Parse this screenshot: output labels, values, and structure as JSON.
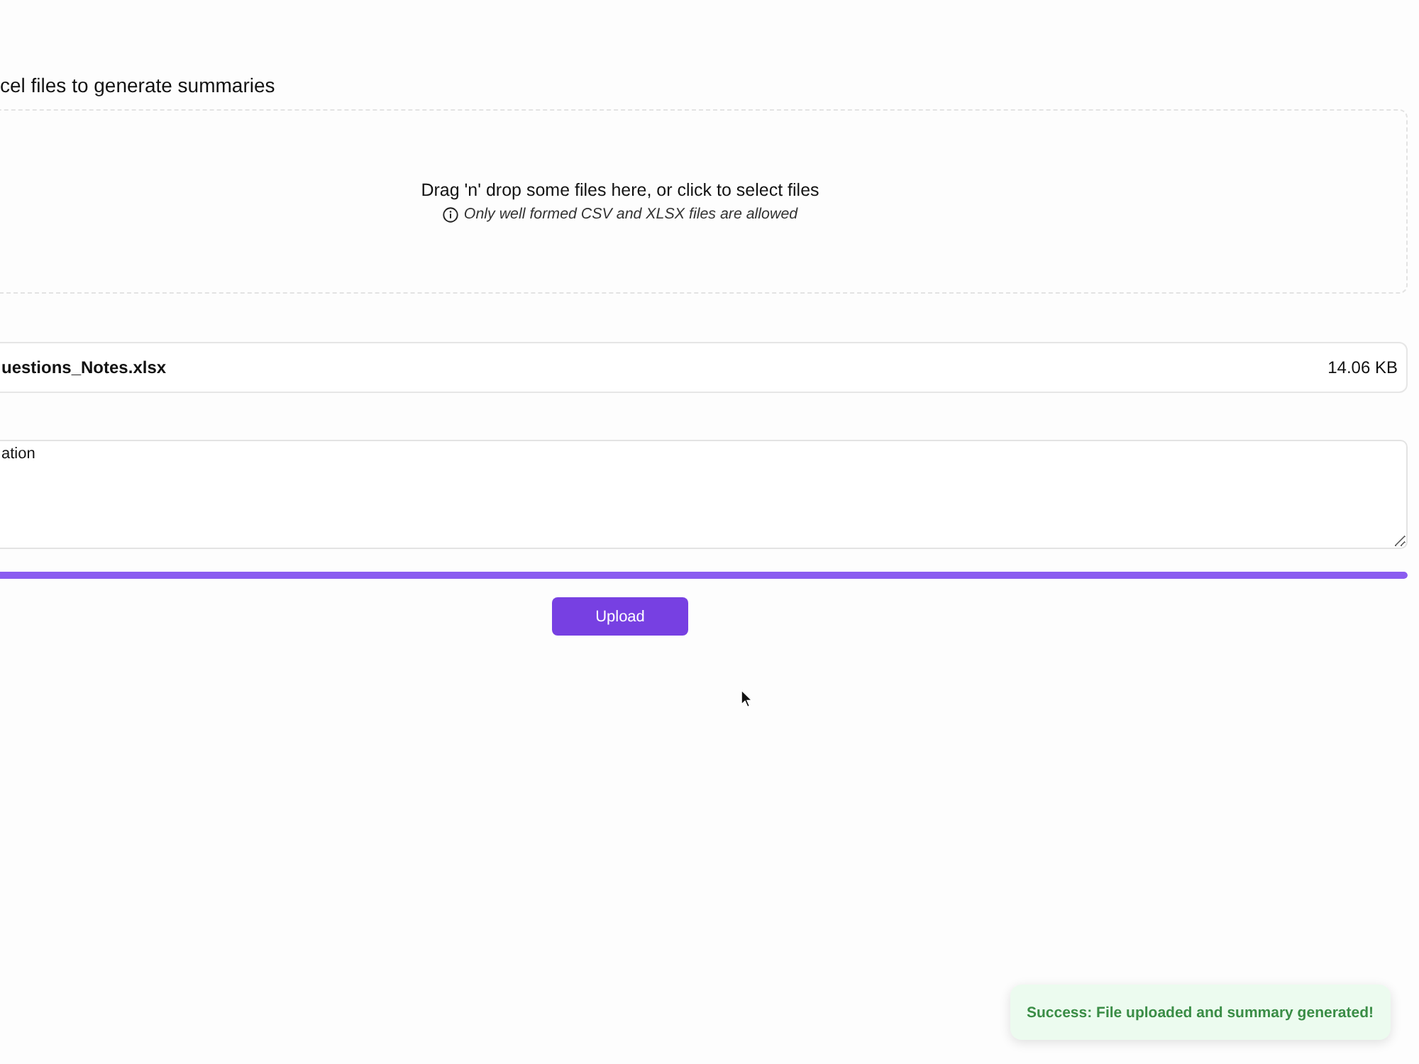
{
  "heading": "cel files to generate summaries",
  "dropzone": {
    "prompt": "Drag 'n' drop some files here, or click to select files",
    "hint": "Only well formed CSV and XLSX files are allowed"
  },
  "file": {
    "name": "uestions_Notes.xlsx",
    "size": "14.06 KB"
  },
  "description": {
    "value": "ation"
  },
  "progress": {
    "level": 1
  },
  "buttons": [
    {
      "label": "Upload",
      "kind": "primary"
    }
  ],
  "toast": {
    "kind": "success",
    "message": "Success: File uploaded and summary generated!"
  }
}
